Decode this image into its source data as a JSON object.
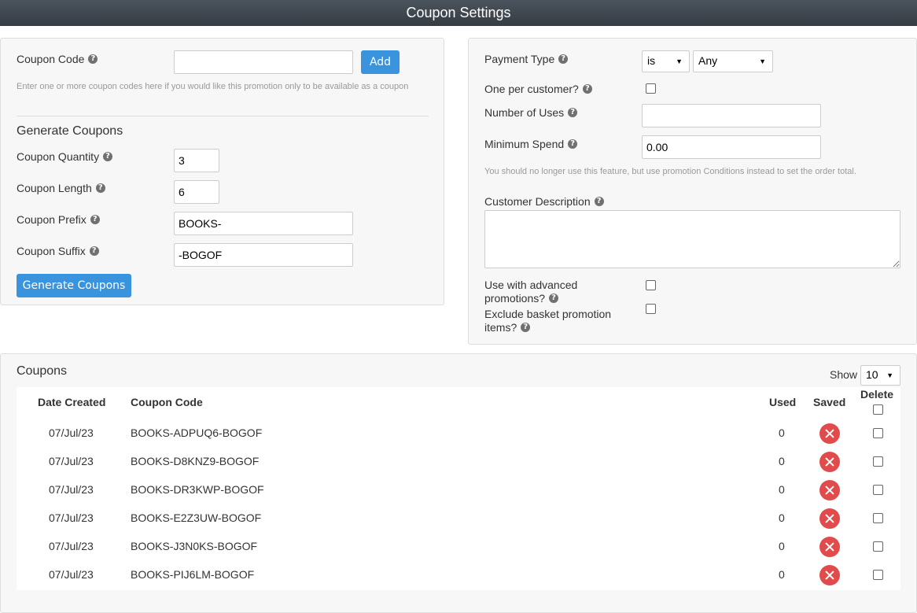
{
  "window": {
    "title": "Coupon Settings"
  },
  "left_panel": {
    "coupon_code_label": "Coupon Code",
    "coupon_code_value": "",
    "add_button": "Add",
    "coupon_code_hint": "Enter one or more coupon codes here if you would like this promotion only to be available as a coupon",
    "generate_heading": "Generate Coupons",
    "quantity_label": "Coupon Quantity",
    "quantity_value": "3",
    "length_label": "Coupon Length",
    "length_value": "6",
    "prefix_label": "Coupon Prefix",
    "prefix_value": "BOOKS-",
    "suffix_label": "Coupon Suffix",
    "suffix_value": "-BOGOF",
    "generate_button": "Generate Coupons"
  },
  "right_panel": {
    "payment_type_label": "Payment Type",
    "payment_operator": "is",
    "payment_value": "Any",
    "one_per_customer_label": "One per customer?",
    "one_per_customer_checked": false,
    "number_of_uses_label": "Number of Uses",
    "number_of_uses_value": "",
    "minimum_spend_label": "Minimum Spend",
    "minimum_spend_value": "0.00",
    "minimum_spend_hint": "You should no longer use this feature, but use promotion Conditions instead to set the order total.",
    "customer_description_label": "Customer Description",
    "customer_description_value": "",
    "advanced_label_line1": "Use with advanced",
    "advanced_label_line2": "promotions?",
    "advanced_checked": false,
    "exclude_label_line1": "Exclude basket promotion",
    "exclude_label_line2": "items?",
    "exclude_checked": false
  },
  "coupons": {
    "heading": "Coupons",
    "show_label": "Show",
    "show_value": "10",
    "columns": {
      "date": "Date Created",
      "code": "Coupon Code",
      "used": "Used",
      "saved": "Saved",
      "delete": "Delete"
    },
    "rows": [
      {
        "date": "07/Jul/23",
        "code": "BOOKS-ADPUQ6-BOGOF",
        "used": "0"
      },
      {
        "date": "07/Jul/23",
        "code": "BOOKS-D8KNZ9-BOGOF",
        "used": "0"
      },
      {
        "date": "07/Jul/23",
        "code": "BOOKS-DR3KWP-BOGOF",
        "used": "0"
      },
      {
        "date": "07/Jul/23",
        "code": "BOOKS-E2Z3UW-BOGOF",
        "used": "0"
      },
      {
        "date": "07/Jul/23",
        "code": "BOOKS-J3N0KS-BOGOF",
        "used": "0"
      },
      {
        "date": "07/Jul/23",
        "code": "BOOKS-PIJ6LM-BOGOF",
        "used": "0"
      }
    ]
  },
  "colors": {
    "accent": "#3a93dd",
    "delete_red": "#e24b4b",
    "title_bar": "#3d444c"
  }
}
